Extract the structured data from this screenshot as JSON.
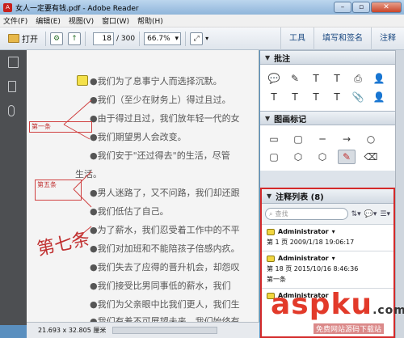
{
  "window": {
    "title": "女人一定要有钱.pdf - Adobe Reader",
    "app_icon": "A",
    "minimize": "–",
    "maximize": "▫",
    "close": "✕"
  },
  "menu": [
    "文件(F)",
    "编辑(E)",
    "视图(V)",
    "窗口(W)",
    "帮助(H)"
  ],
  "toolbar": {
    "open_label": "打开",
    "page_current": "18",
    "page_total": "/ 300",
    "zoom": "66.7%",
    "tabs": [
      "工具",
      "填写和签名",
      "注释"
    ]
  },
  "document": {
    "lines": [
      "●我们为了息事宁人而选择沉默。",
      "●我们（至少在财务上）得过且过。",
      "●由于得过且过，我们放年轻一代的女",
      "●我们期望男人会改变。",
      "●我们安于\"还过得去\"的生活，尽管",
      "生活。",
      "●男人迷路了，又不问路，我们却还跟",
      "●我们低估了自己。",
      "●为了薪水，我们忍受着工作中的不平",
      "●我们对加班和不能陪孩子倍感内疚。",
      "●我们失去了应得的晋升机会，却怨叹",
      "●我们接受比男同事低的薪水，我们",
      "●我们为父亲眼中比我们更人，我们生",
      "●我们有着不可展望未来，我们始终有"
    ],
    "annotations": [
      "第一条",
      "第五条"
    ],
    "handwriting": "第七条"
  },
  "status": {
    "size": "21.693 x 32.805 厘米"
  },
  "panel": {
    "comment_section": "批注",
    "drawing_section": "图画标记",
    "comment_tools": [
      "💬",
      "✎",
      "T",
      "T",
      "⎙",
      "👤",
      "T",
      "T",
      "T",
      "T",
      "📎",
      "👤"
    ],
    "drawing_tools": [
      "▭",
      "▢",
      "─",
      "→",
      "○",
      "▢",
      "⬡",
      "⬡",
      "✎",
      "⌫"
    ],
    "list": {
      "title": "注释列表 (8)",
      "search_placeholder": "查找",
      "entries": [
        {
          "author": "Administrator",
          "meta": "第 1 页 2009/1/18 19:06:17",
          "body": ""
        },
        {
          "author": "Administrator",
          "meta": "第 18 页 2015/10/16 8:46:36",
          "body": "第一条"
        },
        {
          "author": "Administrator",
          "meta": "",
          "body": ""
        }
      ]
    }
  },
  "watermark": {
    "main": "aspku",
    "sub": "免费网站源码下载站",
    "com": ".com"
  }
}
